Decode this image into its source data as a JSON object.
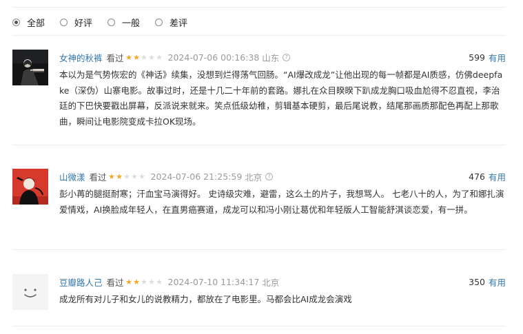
{
  "filters": [
    {
      "label": "全部",
      "checked": true
    },
    {
      "label": "好评",
      "checked": false
    },
    {
      "label": "一般",
      "checked": false
    },
    {
      "label": "差评",
      "checked": false
    }
  ],
  "comments": [
    {
      "user": "女神的秋裤",
      "status": "看过",
      "rating": 2,
      "time": "2024-07-06 00:16:38",
      "location": "山东",
      "votes": "599",
      "useful_label": "有用",
      "text": "本以为是气势恢宏的《神话》续集，没想到烂得荡气回肠。“AI爆改成龙”让他出现的每一帧都是AI质感，仿佛deepfake（深伪）山寨电影。故事过时，还是十几二十年前的套路。娜扎在众目睽睽下趴成龙胸口吸血尬得不忍直视，李治廷的下巴快要戳出屏幕，反派说来就来。笑点低级幼稚，剪辑基本硬剪，最后尾说教，结尾那画质那配色再配上那歌曲，瞬间让电影院变成卡拉OK现场。"
    },
    {
      "user": "山微漾",
      "status": "看过",
      "rating": 2,
      "time": "2024-07-06 21:25:59",
      "location": "北京",
      "votes": "476",
      "useful_label": "有用",
      "text": "彭小苒的腿挺耐寒；汗血宝马演得好。 史诗级灾难，避雷，这么土的片子，我想骂人。 七老八十的人，为了和娜扎演爱情戏，AI换脸成年轻人，在直男癌赛道，成龙可以和冯小刚让葛优和年轻版人工智能舒淇谈恋爱，有一拼。"
    },
    {
      "user": "豆瓣路人己",
      "status": "看过",
      "rating": 2,
      "time": "2024-07-10 11:34:17",
      "location": "北京",
      "votes": "350",
      "useful_label": "有用",
      "text": "成龙所有对儿子和女儿的说教精力，都放在了电影里。马都会比AI成龙会演戏"
    }
  ]
}
